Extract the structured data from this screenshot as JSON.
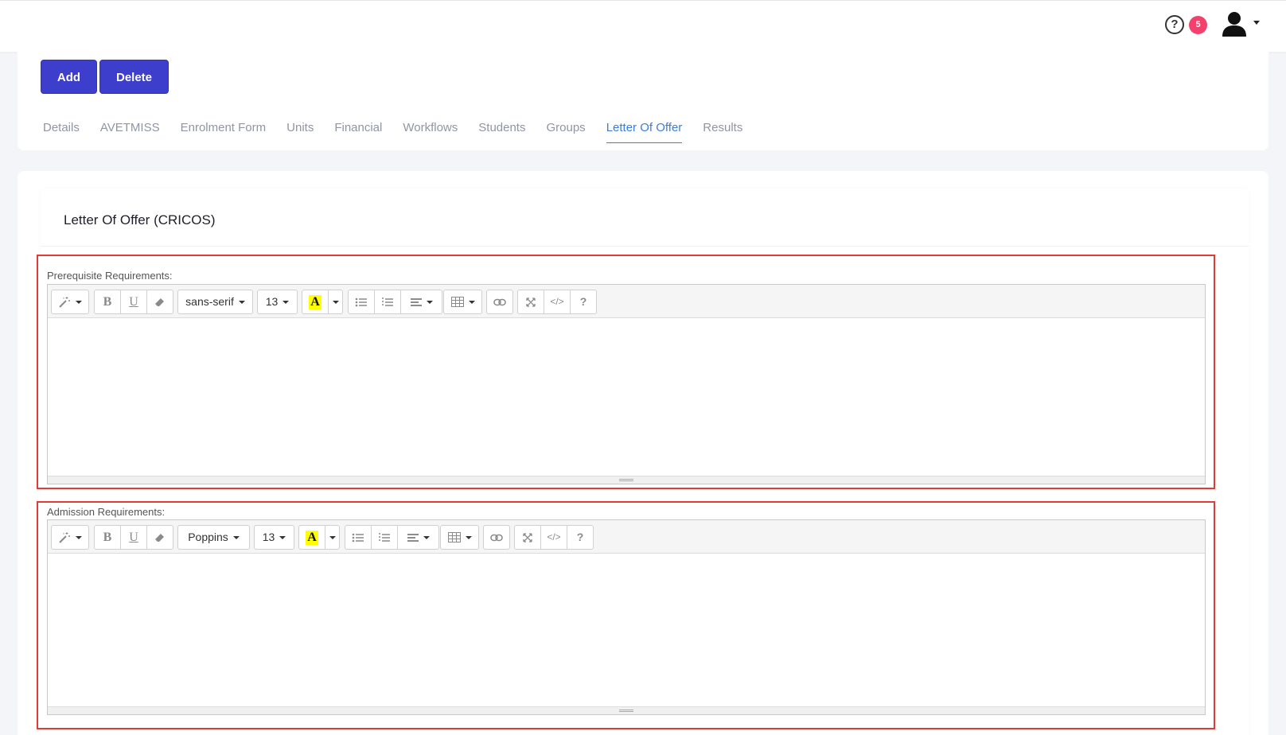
{
  "header": {
    "help_symbol": "?",
    "notification_count": "5"
  },
  "actions": {
    "add_label": "Add",
    "delete_label": "Delete"
  },
  "tabs": [
    {
      "label": "Details"
    },
    {
      "label": "AVETMISS"
    },
    {
      "label": "Enrolment Form"
    },
    {
      "label": "Units"
    },
    {
      "label": "Financial"
    },
    {
      "label": "Workflows"
    },
    {
      "label": "Students"
    },
    {
      "label": "Groups"
    },
    {
      "label": "Letter Of Offer",
      "active": true
    },
    {
      "label": "Results"
    }
  ],
  "section": {
    "title": "Letter Of Offer (CRICOS)"
  },
  "editors": [
    {
      "label": "Prerequisite Requirements:",
      "font_family": "sans-serif",
      "font_size": "13"
    },
    {
      "label": "Admission Requirements:",
      "font_family": "Poppins",
      "font_size": "13"
    }
  ],
  "toolbar_glyphs": {
    "bold": "B",
    "underline": "U",
    "highlight": "A",
    "code": "</>",
    "help": "?"
  },
  "colors": {
    "primary_button": "#3d3ecc",
    "active_tab": "#3b7ddd",
    "badge": "#f1416c",
    "highlight_box": "#e53935"
  }
}
